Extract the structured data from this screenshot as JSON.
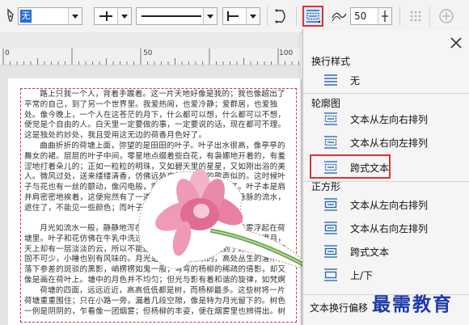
{
  "toolbar": {
    "fill_color_label": "无",
    "line_width_value": "50",
    "outline_icon": "pen-nib-icon",
    "wrap_icon": "text-wrap-icon"
  },
  "ruler": {
    "labels": [
      "0",
      "50",
      "100"
    ]
  },
  "article": {
    "paragraphs": [
      "路上只我一个人，背着手踱着。这一片天地好像是我的；我也像超出了平常的自己，到了另一个世界里。我爱热闹，也爱冷静；爱群居，也爱独处。像今晚上，一个人在这苍茫的月下，什么都可以想，什么都可以不想，便觉是个自由的人。白天里一定要做的事，一定要说的话，现在都可不理。这是独处的妙处，我且受用这无边的荷香月色好了。",
      "曲曲折折的荷塘上面，弥望的是田田的叶子。叶子出水很高，像亭亭的舞女的裙。层层的叶子中间，零星地点缀着些白花，有袅娜地开着的，有羞涩地打着朵儿的；正如一粒粒的明珠，又如碧天里的星星，又如刚出浴的美人。微风过处，送来缕缕清香，仿佛远处高楼上渺茫的歌声似的。这时候叶子与花也有一丝的颤动，像闪电般，霎时传过荷塘的那边去了。叶子本是肩并肩密密地挨着，这便宛然有了一道凝碧的波痕。叶子底下是脉脉的流水，遮住了，不能见一些颜色；而叶子却更见风致了。",
      "月光如流水一般，静静地泻在这一片叶子和花上。薄薄的青雾浮起在荷塘里。叶子和花仿佛在牛乳中洗过一样；又像笼着轻纱的梦。虽然是满月，天上却有一层淡淡的云，所以不能朗照；但我以为这恰是到了好处——酣眠固不可少，小睡也别有风味的。月光是隔了树照过来的，高处丛生的灌木，落下参差的斑驳的黑影，峭楞楞如鬼一般；弯弯的杨柳的稀疏的倩影，却又像是画在荷叶上。塘中的月色并不均匀；但光与影有着和谐的旋律，如梵婀玲上奏着的名曲。",
      "荷塘的四面，远远近近，高高低低都是树，而杨柳最多。这些树将一片荷塘重重围住；只在小路一旁，漏着几段空隙，像是特为月光留下的。树色一例是阴阴的，乍看像一团烟雾；但杨柳的丰姿，便在烟雾里也辨得出。树梢上隐隐约约的是一带远山，只有些大意罢了。"
    ]
  },
  "panel": {
    "close_icon": "close-icon",
    "section_wrap_style": "换行样式",
    "item_none": "无",
    "section_contour": "轮廓图",
    "contour_left_to_right": "文本从左向右排列",
    "contour_right_to_left": "文本从右向左排列",
    "contour_straddle": "跨式文本",
    "section_square": "正方形",
    "square_left_to_right": "文本从左向右排列",
    "square_right_to_left": "文本从右向左排列",
    "square_straddle": "跨式文本",
    "square_top_bottom": "上/下",
    "wrap_offset_label": "文本换行偏移"
  },
  "watermark": "最需教育",
  "colors": {
    "highlight": "#e03131",
    "icon_blue": "#1f5fbf",
    "watermark": "#1e3aa8"
  }
}
